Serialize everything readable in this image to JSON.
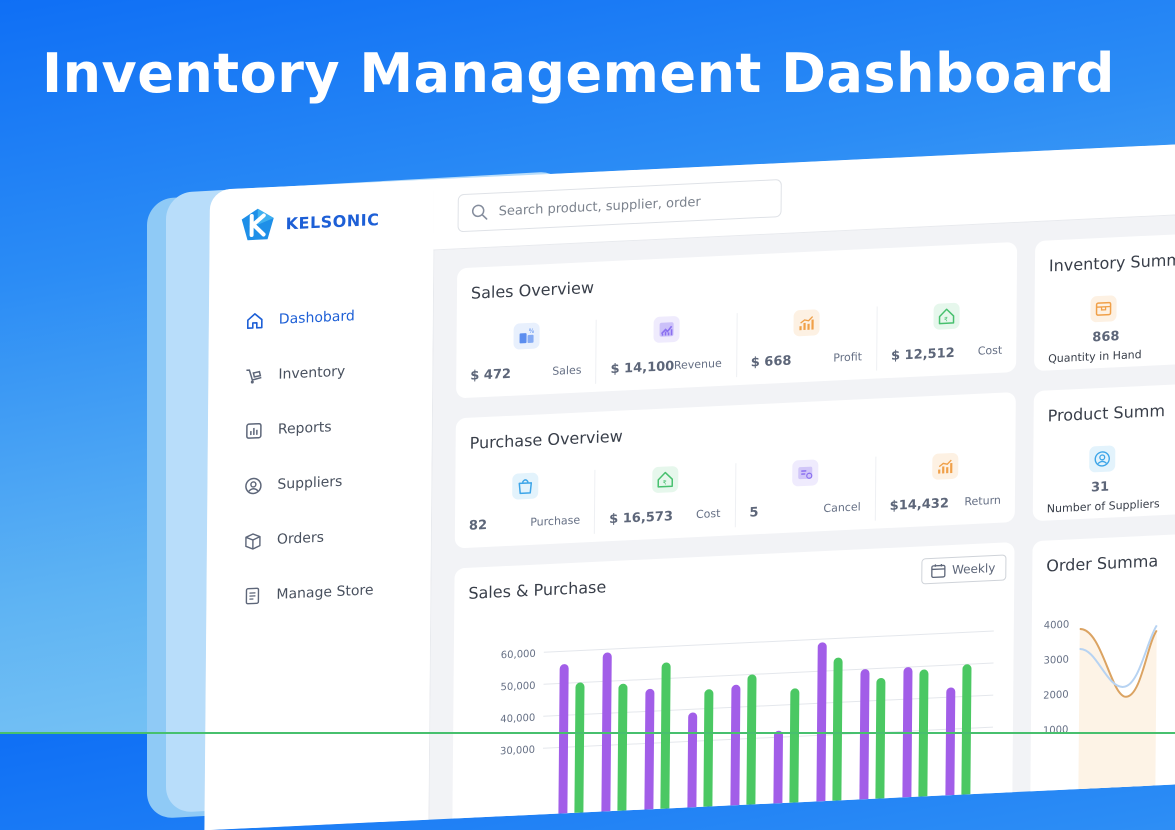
{
  "hero": {
    "title": "Inventory Management Dashboard"
  },
  "brand": {
    "name": "KELSONIC",
    "logo_icon": "kelsonic-logo",
    "accent": "#1d5fd6"
  },
  "search": {
    "placeholder": "Search product, supplier, order"
  },
  "sidebar": {
    "items": [
      {
        "label": "Dashobard",
        "icon": "home-icon",
        "active": true
      },
      {
        "label": "Inventory",
        "icon": "inventory-icon",
        "active": false
      },
      {
        "label": "Reports",
        "icon": "reports-icon",
        "active": false
      },
      {
        "label": "Suppliers",
        "icon": "suppliers-icon",
        "active": false
      },
      {
        "label": "Orders",
        "icon": "orders-icon",
        "active": false
      },
      {
        "label": "Manage Store",
        "icon": "manage-store-icon",
        "active": false
      }
    ]
  },
  "sales_overview": {
    "title": "Sales Overview",
    "metrics": [
      {
        "value": "$ 472",
        "label": "Sales",
        "icon": "sales-icon",
        "color": "#5b8def"
      },
      {
        "value": "$ 14,100",
        "label": "Revenue",
        "icon": "revenue-icon",
        "color": "#8a6ff0"
      },
      {
        "value": "$ 668",
        "label": "Profit",
        "icon": "profit-icon",
        "color": "#f0a049"
      },
      {
        "value": "$ 12,512",
        "label": "Cost",
        "icon": "cost-icon",
        "color": "#47c06e"
      }
    ]
  },
  "purchase_overview": {
    "title": "Purchase Overview",
    "metrics": [
      {
        "value": "82",
        "label": "Purchase",
        "icon": "purchase-bag-icon",
        "color": "#3da5e8"
      },
      {
        "value": "$ 16,573",
        "label": "Cost",
        "icon": "cost-icon",
        "color": "#47c06e"
      },
      {
        "value": "5",
        "label": "Cancel",
        "icon": "cancel-icon",
        "color": "#8a6ff0"
      },
      {
        "value": "$14,432",
        "label": "Return",
        "icon": "return-icon",
        "color": "#f0a049"
      }
    ]
  },
  "inventory_summary": {
    "title": "Inventory Summ",
    "value": "868",
    "label": "Quantity in Hand",
    "icon": "box-icon",
    "color": "#f0a049"
  },
  "product_summary": {
    "title": "Product Summ",
    "value": "31",
    "label": "Number of Suppliers",
    "icon": "supplier-user-icon",
    "color": "#3da5e8"
  },
  "order_summary": {
    "title": "Order Summa",
    "y_ticks": [
      "4000",
      "3000",
      "2000",
      "1000"
    ]
  },
  "sales_purchase": {
    "title": "Sales & Purchase",
    "period_button": "Weekly"
  },
  "chart_data": {
    "type": "bar",
    "title": "Sales & Purchase",
    "y_ticks": [
      "60,000",
      "50,000",
      "40,000",
      "30,000"
    ],
    "ylim": [
      20000,
      65000
    ],
    "grid": true,
    "series": [
      {
        "values": [
          56000,
          59000,
          47000,
          39000,
          47000,
          32000,
          59000,
          50000,
          50000,
          43000
        ],
        "color": "#a25ee8"
      },
      {
        "values": [
          50000,
          49000,
          55000,
          46000,
          50000,
          45000,
          54000,
          47000,
          49000,
          50000
        ],
        "color": "#4bc863"
      }
    ]
  }
}
